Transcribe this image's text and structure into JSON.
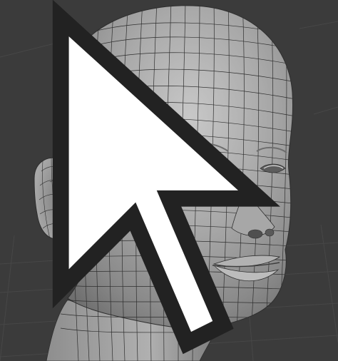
{
  "viewport": {
    "background_color": "#3b3b3b",
    "grid_color": "#474747",
    "mesh_fill_color": "#a3a3a3",
    "mesh_highlight_color": "#c4c4c4",
    "mesh_shadow_color": "#6e6e6e",
    "wire_color": "#2e2e2e",
    "selected_vertex_color": "#ff8a1f",
    "cursor_icon": "arrow-cursor-icon"
  }
}
